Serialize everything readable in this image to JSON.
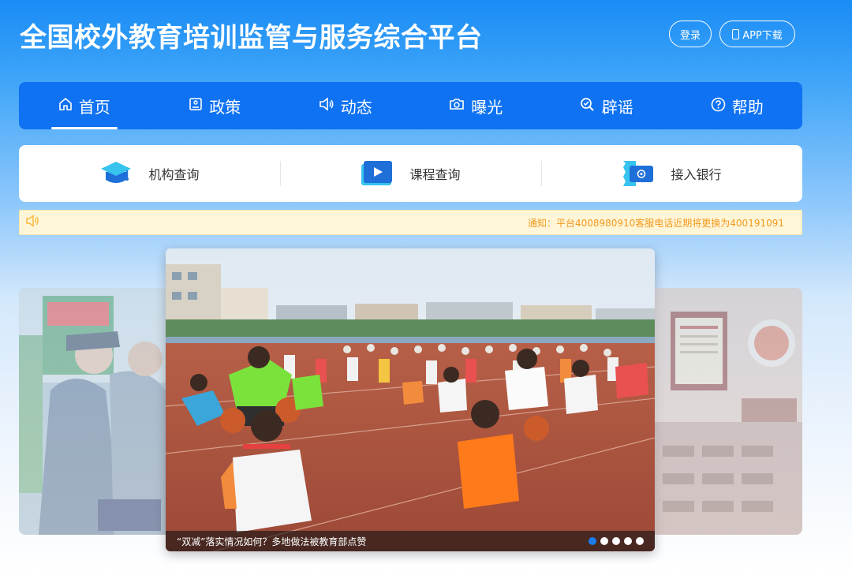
{
  "header": {
    "title": "全国校外教育培训监管与服务综合平台",
    "login_label": "登录",
    "app_label": "APP下载"
  },
  "nav": {
    "items": [
      {
        "label": "首页",
        "icon": "home-icon",
        "active": true
      },
      {
        "label": "政策",
        "icon": "policy-icon"
      },
      {
        "label": "动态",
        "icon": "speaker-icon"
      },
      {
        "label": "曝光",
        "icon": "camera-icon"
      },
      {
        "label": "辟谣",
        "icon": "search-check-icon"
      },
      {
        "label": "帮助",
        "icon": "help-icon"
      }
    ]
  },
  "quick": {
    "items": [
      {
        "label": "机构查询",
        "icon": "graduation-cap-icon"
      },
      {
        "label": "课程查询",
        "icon": "video-play-icon"
      },
      {
        "label": "接入银行",
        "icon": "bank-card-icon"
      }
    ]
  },
  "notice": {
    "icon": "speaker-icon",
    "text": "通知：平台4008980910客服电话近期将更换为400191091"
  },
  "carousel": {
    "caption": "“双减”落实情况如何？多地做法被教育部点赞",
    "slide_count": 5,
    "active_index": 0
  },
  "colors": {
    "nav_bg": "#0f72f2",
    "notice_text": "#f39a1d",
    "active_dot": "#1d7bf0"
  }
}
